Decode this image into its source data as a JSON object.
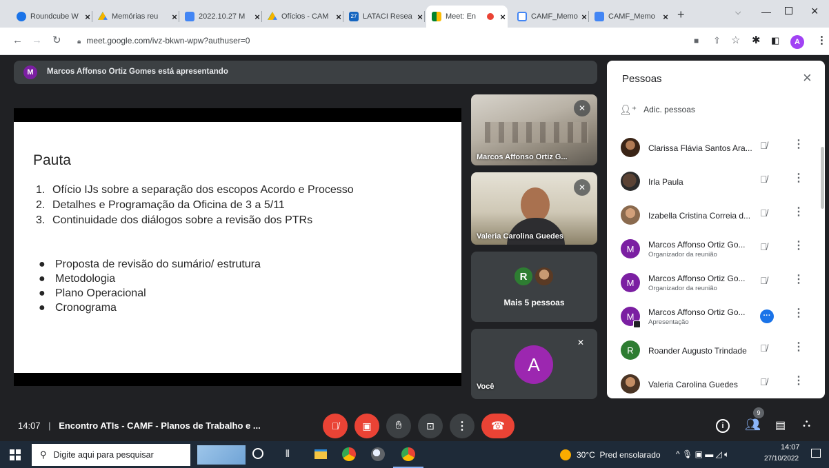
{
  "tabs": [
    {
      "label": "Roundcube W",
      "color": "#1a73e8"
    },
    {
      "label": "Memórias reu",
      "color": "#f4b400"
    },
    {
      "label": "2022.10.27 M",
      "color": "#4285f4"
    },
    {
      "label": "Ofícios - CAM",
      "color": "#f4b400"
    },
    {
      "label": "LATACI Resea",
      "color": "#1565c0"
    },
    {
      "label": "Meet: En",
      "color": "#00832d"
    },
    {
      "label": "CAMF_Memo",
      "color": "#4285f4"
    },
    {
      "label": "CAMF_Memo",
      "color": "#4285f4"
    }
  ],
  "browser": {
    "url": "meet.google.com/ivz-bkwn-wpw?authuser=0",
    "profile_initial": "A",
    "new_tab": "+",
    "accent": "#1a73e8"
  },
  "presenting": {
    "initial": "M",
    "text": "Marcos Affonso Ortiz Gomes está apresentando"
  },
  "slide": {
    "title": "Pauta",
    "numbered": [
      {
        "num": "1.",
        "text": "Ofício IJs sobre a separação dos escopos Acordo e Processo"
      },
      {
        "num": "2.",
        "text": "Detalhes e Programação da Oficina de 3 a 5/11"
      },
      {
        "num": "3.",
        "text": "Continuidade dos diálogos sobre a revisão dos PTRs"
      }
    ],
    "bullets": [
      "Proposta de revisão do sumário/ estrutura",
      "Metodologia",
      "Plano Operacional",
      "Cronograma"
    ]
  },
  "tiles": {
    "t1": {
      "name": "Marcos Affonso Ortiz G..."
    },
    "t2": {
      "name": "Valeria Carolina Guedes"
    },
    "t3": {
      "initial": "R",
      "caption": "Mais 5 pessoas"
    },
    "t4": {
      "initial": "A",
      "name": "Você"
    }
  },
  "people": {
    "title": "Pessoas",
    "add_label": "Adic. pessoas",
    "list": [
      {
        "name": "Clarissa Flávia Santos Ara...",
        "sub": "",
        "avatar": "photo"
      },
      {
        "name": "Irla Paula",
        "sub": "",
        "avatar": "photo"
      },
      {
        "name": "Izabella Cristina Correia d...",
        "sub": "",
        "avatar": "photo"
      },
      {
        "name": "Marcos Affonso Ortiz Go...",
        "sub": "Organizador da reunião",
        "initial": "M",
        "color": "#7b1fa2"
      },
      {
        "name": "Marcos Affonso Ortiz Go...",
        "sub": "Organizador da reunião",
        "initial": "M",
        "color": "#7b1fa2"
      },
      {
        "name": "Marcos Affonso Ortiz Go...",
        "sub": "Apresentação",
        "initial": "M",
        "color": "#7b1fa2"
      },
      {
        "name": "Roander Augusto Trindade",
        "sub": "",
        "initial": "R",
        "color": "#2e7d32"
      },
      {
        "name": "Valeria Carolina Guedes",
        "sub": "",
        "avatar": "photo"
      }
    ]
  },
  "bottom": {
    "time": "14:07",
    "separator": "|",
    "meeting": "Encontro ATIs - CAMF - Planos de Trabalho e ...",
    "people_count": "9",
    "end_color": "#ea4335"
  },
  "taskbar": {
    "search": "Digite aqui para pesquisar",
    "weather": "30°C  Pred ensolarado",
    "time": "14:07",
    "date": "27/10/2022"
  }
}
